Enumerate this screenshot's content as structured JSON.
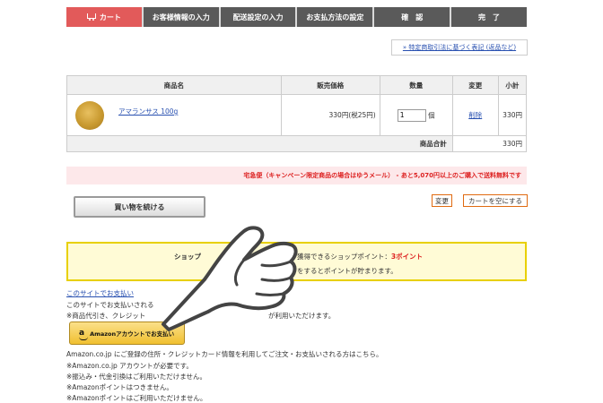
{
  "steps": [
    "カート",
    "お客様情報の入力",
    "配送設定の入力",
    "お支払方法の設定",
    "確　認",
    "完　了"
  ],
  "law_link": "» 特定商取引法に基づく表記 (返品など)",
  "table": {
    "headers": [
      "商品名",
      "販売価格",
      "数量",
      "変更",
      "小計"
    ],
    "item": {
      "name": "アマランサス 100g",
      "price": "330円(税25円)",
      "qty": "1",
      "qty_unit": "個",
      "action": "削除",
      "subtotal": "330円"
    },
    "total_label": "商品合計",
    "total_value": "330円"
  },
  "ship_notice": "宅急便（キャンペーン限定商品の場合はゆうメール） - あと5,070円以上のご購入で送料無料です",
  "buttons": {
    "continue": "買い物を続ける",
    "change": "変更",
    "empty_cart": "カートを空にする"
  },
  "points": {
    "label": "ショップ",
    "line1_prefix": "獲得できるショップポイント：",
    "line1_value": "3ポイント",
    "line2": "をするとポイントが貯まります。"
  },
  "payment": {
    "link": "このサイトでお支払い",
    "line1": "このサイトでお支払いされる",
    "line2": "※商品代引き、クレジット",
    "line2b": "が利用いただけます。",
    "amazon_logo": "a",
    "amazon_button": "Amazonアカウントでお支払い",
    "notes": [
      "Amazon.co.jp にご登録の住所・クレジットカード情報を利用してご注文・お支払いされる方はこちら。",
      "※Amazon.co.jp アカウントが必要です。",
      "※振込み・代金引換はご利用いただけません。",
      "※Amazonポイントはつきません。",
      "※Amazonポイントはご利用いただけません。"
    ]
  },
  "colors": {
    "accent_red": "#e25a5a",
    "step_gray": "#5a5a5a",
    "link": "#2850b0",
    "warn_red": "#dd2222"
  }
}
